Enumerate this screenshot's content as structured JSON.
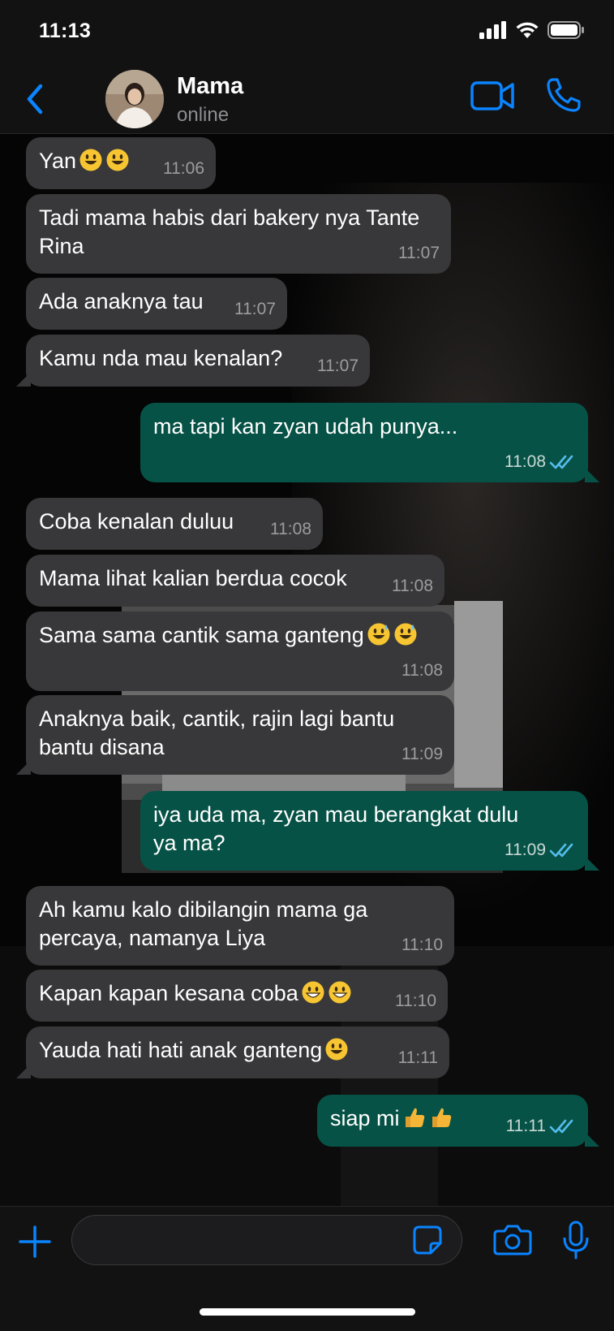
{
  "status_bar": {
    "time": "11:13"
  },
  "header": {
    "contact_name": "Mama",
    "contact_status": "online"
  },
  "messages": [
    {
      "dir": "in",
      "text": "Yan",
      "emoji": [
        "smiley",
        "smiley"
      ],
      "time": "11:06"
    },
    {
      "dir": "in",
      "text": "Tadi mama habis dari bakery nya Tante\nRina",
      "time": "11:07"
    },
    {
      "dir": "in",
      "text": "Ada anaknya tau",
      "time": "11:07"
    },
    {
      "dir": "in",
      "text": "Kamu nda mau kenalan?",
      "time": "11:07"
    },
    {
      "dir": "out",
      "text": "ma tapi kan zyan udah punya...",
      "time": "11:08",
      "read": true
    },
    {
      "dir": "in",
      "text": "Coba kenalan duluu",
      "time": "11:08"
    },
    {
      "dir": "in",
      "text": "Mama lihat kalian berdua cocok",
      "time": "11:08"
    },
    {
      "dir": "in",
      "text": "Sama sama cantik sama ganteng",
      "emoji": [
        "sweat-smile",
        "sweat-smile"
      ],
      "time": "11:08"
    },
    {
      "dir": "in",
      "text": "Anaknya baik, cantik, rajin lagi bantu\nbantu disana",
      "time": "11:09"
    },
    {
      "dir": "out",
      "text": "iya uda ma, zyan mau berangkat dulu\nya ma?",
      "time": "11:09",
      "read": true
    },
    {
      "dir": "in",
      "text": "Ah kamu kalo dibilangin mama ga\npercaya, namanya Liya",
      "time": "11:10"
    },
    {
      "dir": "in",
      "text": "Kapan kapan kesana coba",
      "emoji": [
        "grin",
        "grin"
      ],
      "time": "11:10"
    },
    {
      "dir": "in",
      "text": "Yauda hati hati anak ganteng",
      "emoji": [
        "smiley"
      ],
      "time": "11:11"
    },
    {
      "dir": "out",
      "text": "siap mi",
      "emoji": [
        "thumbs-up",
        "thumbs-up"
      ],
      "time": "11:11",
      "read": true
    }
  ],
  "input": {
    "placeholder": "",
    "value": ""
  },
  "colors": {
    "accent": "#0a84ff",
    "incoming_bubble": "#38383a",
    "outgoing_bubble": "#075246",
    "read_ticks": "#53bdeb"
  }
}
